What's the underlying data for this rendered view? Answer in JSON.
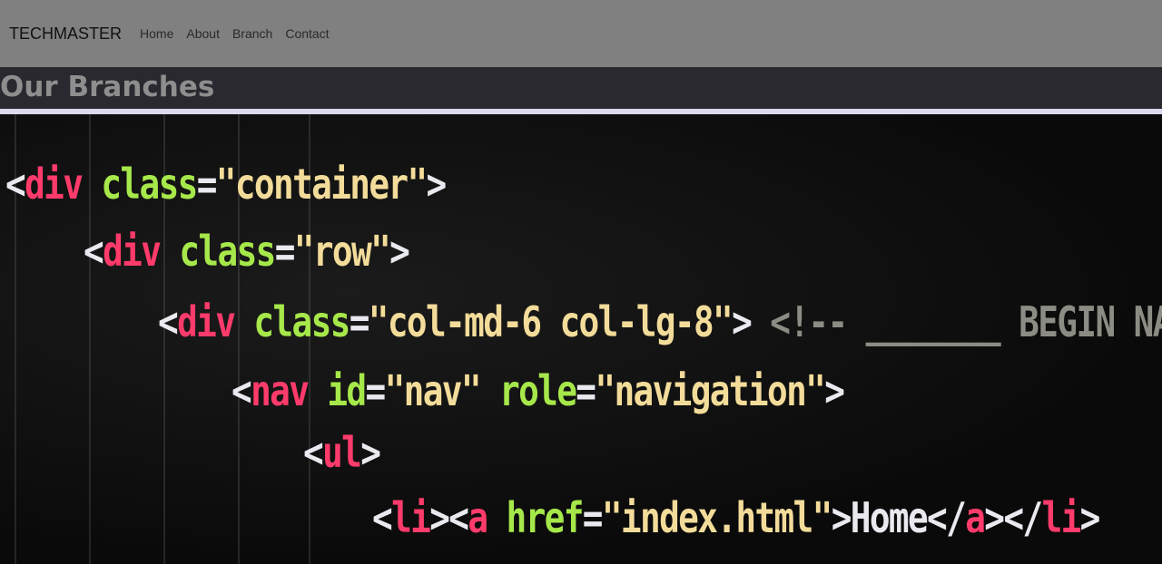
{
  "navbar": {
    "brand": "TECHMASTER",
    "links": [
      "Home",
      "About",
      "Branch",
      "Contact"
    ]
  },
  "page": {
    "title": "Our Branches"
  },
  "hero": {
    "lines": [
      {
        "tokens": [
          [
            "t-br",
            "<"
          ],
          [
            "t-tag",
            "div"
          ],
          [
            "t-attr",
            " class"
          ],
          [
            "t-br",
            "="
          ],
          [
            "t-str",
            "\"container\""
          ],
          [
            "t-br",
            ">"
          ]
        ]
      },
      {
        "tokens": [
          [
            "t-br",
            "<"
          ],
          [
            "t-tag",
            "div"
          ],
          [
            "t-attr",
            " class"
          ],
          [
            "t-br",
            "="
          ],
          [
            "t-str",
            "\"row\""
          ],
          [
            "t-br",
            ">"
          ]
        ]
      },
      {
        "tokens": [
          [
            "t-br",
            "<"
          ],
          [
            "t-tag",
            "div"
          ],
          [
            "t-attr",
            " class"
          ],
          [
            "t-br",
            "="
          ],
          [
            "t-str",
            "\"col-md-6 col-lg-8\""
          ],
          [
            "t-br",
            ">"
          ],
          [
            "t-cm",
            " <!-- _______ BEGIN NAVIGATION"
          ]
        ]
      },
      {
        "tokens": [
          [
            "t-br",
            "<"
          ],
          [
            "t-tag",
            "nav"
          ],
          [
            "t-attr",
            " id"
          ],
          [
            "t-br",
            "="
          ],
          [
            "t-str",
            "\"nav\""
          ],
          [
            "t-attr",
            " role"
          ],
          [
            "t-br",
            "="
          ],
          [
            "t-str",
            "\"navigation\""
          ],
          [
            "t-br",
            ">"
          ]
        ]
      },
      {
        "tokens": [
          [
            "t-br",
            "<"
          ],
          [
            "t-tag",
            "ul"
          ],
          [
            "t-br",
            ">"
          ]
        ]
      },
      {
        "tokens": [
          [
            "t-br",
            "<"
          ],
          [
            "t-tag",
            "li"
          ],
          [
            "t-br",
            "><"
          ],
          [
            "t-tag",
            "a"
          ],
          [
            "t-attr",
            " href"
          ],
          [
            "t-br",
            "="
          ],
          [
            "t-str",
            "\"index.html\""
          ],
          [
            "t-br",
            ">Home</"
          ],
          [
            "t-tag",
            "a"
          ],
          [
            "t-br",
            "></"
          ],
          [
            "t-tag",
            "li"
          ],
          [
            "t-br",
            ">"
          ]
        ]
      }
    ]
  }
}
